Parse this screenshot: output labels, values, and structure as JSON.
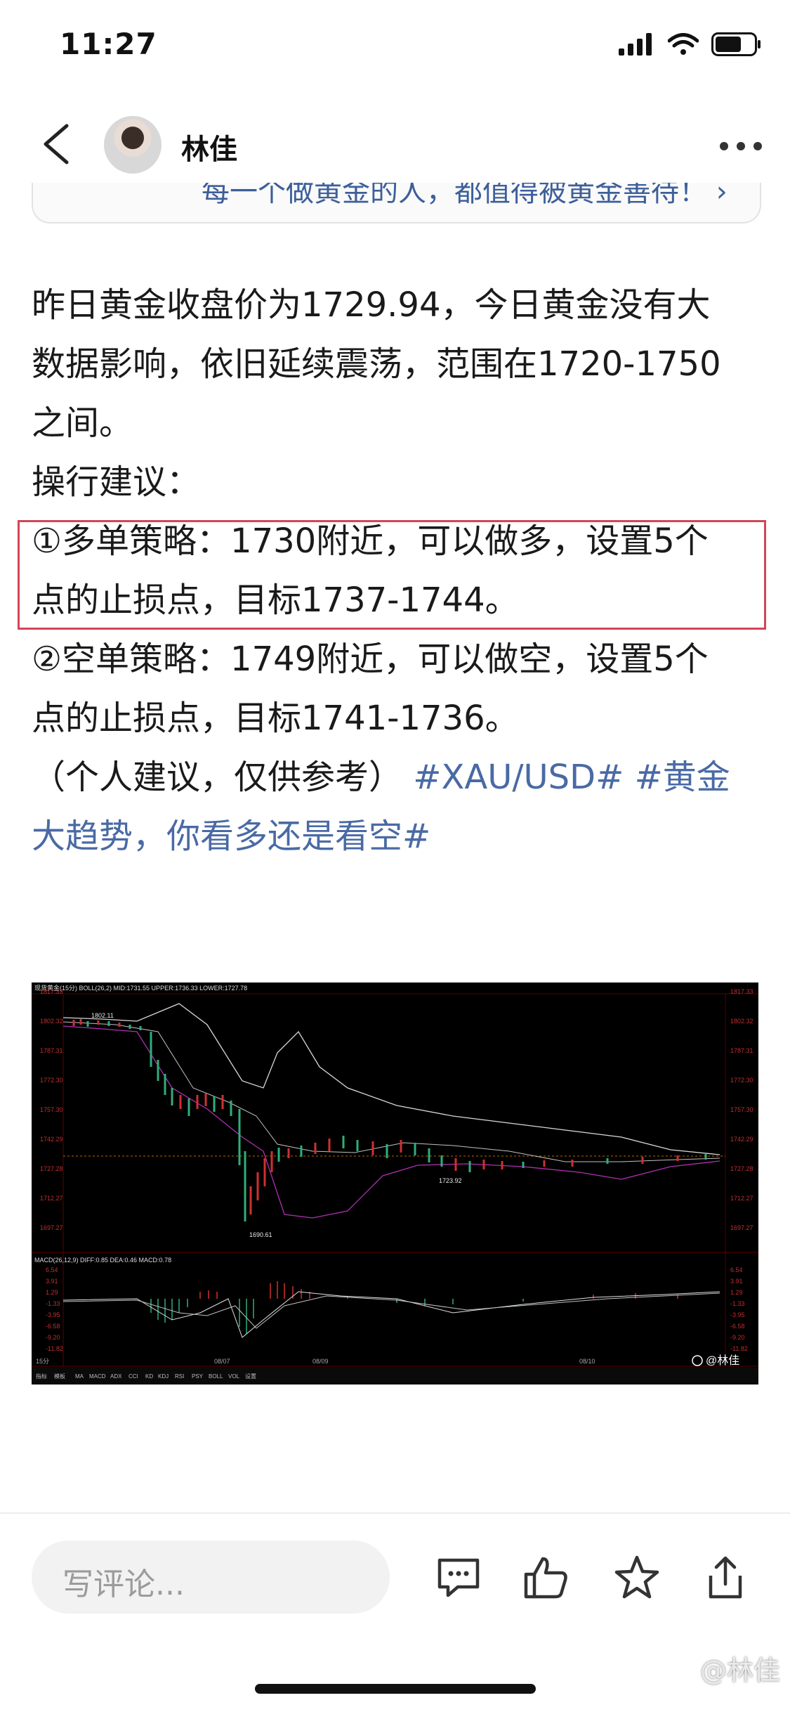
{
  "status_bar": {
    "time": "11:27"
  },
  "header": {
    "author": "林佳"
  },
  "quoted_card": {
    "text": "每一个做黄金的人，都值得被黄金善待！ ›"
  },
  "article": {
    "line1": "昨日黄金收盘价为1729.94，今日黄金没有大",
    "line2": "数据影响，依旧延续震荡，范围在1720-1750",
    "line3": "之间。",
    "line4": "操行建议：",
    "line5": "①多单策略：1730附近，可以做多，设置5个",
    "line6": "点的止损点，目标1737-1744。",
    "line7": "②空单策略：1749附近，可以做空，设置5个",
    "line8": "点的止损点，目标1741-1736。",
    "line9_text": "（个人建议，仅供参考）",
    "line9_tag": "#XAU/USD#",
    "line9_tag2": "#黄金",
    "line10_tag": "大趋势，你看多还是看空#"
  },
  "chart_image": {
    "title_bar": "现货黄金(15分) BOLL(26,2) MID:1731.55 UPPER:1736.33 LOWER:1727.78",
    "macd_label": "MACD(26,12,9) DIFF:0.85 DEA:0.46 MACD:0.78",
    "y_labels": [
      "1817.33",
      "1802.32",
      "1787.31",
      "1772.30",
      "1757.30",
      "1742.29",
      "1727.28",
      "1712.27",
      "1697.27"
    ],
    "macd_labels": [
      "6.54",
      "3.91",
      "1.29",
      "-1.33",
      "-3.95",
      "-6.58",
      "-9.20",
      "-11.82"
    ],
    "annotations": [
      "1802.11",
      "1690.61",
      "1723.92"
    ],
    "x_labels": [
      "08/07",
      "08/09",
      "08/10"
    ],
    "period": "15分",
    "tabs": [
      "指标",
      "模板",
      "MA",
      "MACD",
      "ADX",
      "CCI",
      "KD",
      "KDJ",
      "RSI",
      "PSY",
      "BOLL",
      "VOL",
      "设置"
    ],
    "watermark": "@林佳"
  },
  "bottom_bar": {
    "comment_placeholder": "写评论...",
    "icons": [
      "comment-icon",
      "like-icon",
      "star-icon",
      "share-icon"
    ]
  },
  "corner_watermark": "@林佳"
}
